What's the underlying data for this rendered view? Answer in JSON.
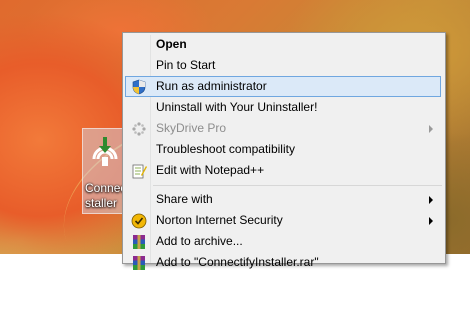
{
  "desktop_icon": {
    "label_line1": "Connec",
    "label_line2": "staller"
  },
  "context_menu": {
    "items": [
      {
        "label": "Open",
        "bold": true
      },
      {
        "label": "Pin to Start"
      },
      {
        "label": "Run as administrator",
        "highlighted": true,
        "icon": "uac-shield-icon"
      },
      {
        "label": "Uninstall with Your Uninstaller!"
      },
      {
        "label": "SkyDrive Pro",
        "disabled": true,
        "submenu": true,
        "icon": "skydrive-icon"
      },
      {
        "label": "Troubleshoot compatibility"
      },
      {
        "label": "Edit with Notepad++",
        "icon": "notepad-plus-plus-icon"
      },
      {
        "label": "Share with",
        "submenu": true
      },
      {
        "label": "Norton Internet Security",
        "submenu": true,
        "icon": "norton-icon"
      },
      {
        "label": "Add to archive...",
        "icon": "winrar-icon"
      },
      {
        "label": "Add to \"ConnectifyInstaller.rar\"",
        "icon": "winrar-icon"
      }
    ]
  }
}
